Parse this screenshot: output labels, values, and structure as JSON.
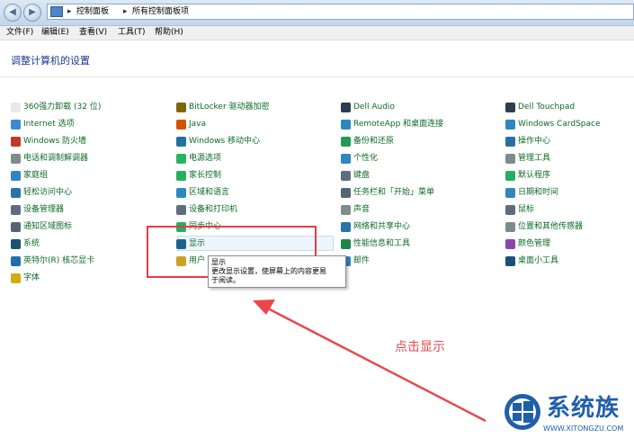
{
  "breadcrumb": [
    "控制面板",
    "所有控制面板项"
  ],
  "menu": [
    "文件(F)",
    "编辑(E)",
    "查看(V)",
    "工具(T)",
    "帮助(H)"
  ],
  "page_title": "调整计算机的设置",
  "columns": [
    [
      {
        "label": "360强力卸载 (32 位)",
        "icon_color": "#e9e9e9"
      },
      {
        "label": "Internet 选项",
        "icon_color": "#3b8ad9"
      },
      {
        "label": "Windows 防火墙",
        "icon_color": "#c0392b"
      },
      {
        "label": "电话和调制解调器",
        "icon_color": "#7f8c8d"
      },
      {
        "label": "家庭组",
        "icon_color": "#2e86c1"
      },
      {
        "label": "轻松访问中心",
        "icon_color": "#2874a6"
      },
      {
        "label": "设备管理器",
        "icon_color": "#5d6d7e"
      },
      {
        "label": "通知区域图标",
        "icon_color": "#566573"
      },
      {
        "label": "系统",
        "icon_color": "#1a5276"
      },
      {
        "label": "英特尔(R) 核芯显卡",
        "icon_color": "#1f6fb2"
      },
      {
        "label": "字体",
        "icon_color": "#d4ac0d"
      }
    ],
    [
      {
        "label": "BitLocker 驱动器加密",
        "icon_color": "#7d6608"
      },
      {
        "label": "Java",
        "icon_color": "#d35400"
      },
      {
        "label": "Windows 移动中心",
        "icon_color": "#2471a3"
      },
      {
        "label": "电源选项",
        "icon_color": "#28b463"
      },
      {
        "label": "家长控制",
        "icon_color": "#27ae60"
      },
      {
        "label": "区域和语言",
        "icon_color": "#2e86c1"
      },
      {
        "label": "设备和打印机",
        "icon_color": "#5d6d7e"
      },
      {
        "label": "同步中心",
        "icon_color": "#27ae60"
      },
      {
        "label": "显示",
        "icon_color": "#1f618d"
      },
      {
        "label": "用户",
        "icon_color": "#c9a227"
      }
    ],
    [
      {
        "label": "Dell Audio",
        "icon_color": "#2c3e50"
      },
      {
        "label": "RemoteApp 和桌面连接",
        "icon_color": "#2e86c1"
      },
      {
        "label": "备份和还原",
        "icon_color": "#229954"
      },
      {
        "label": "个性化",
        "icon_color": "#2e86c1"
      },
      {
        "label": "键盘",
        "icon_color": "#5d6d7e"
      },
      {
        "label": "任务栏和「开始」菜单",
        "icon_color": "#566573"
      },
      {
        "label": "声音",
        "icon_color": "#7f8c8d"
      },
      {
        "label": "网络和共享中心",
        "icon_color": "#2874a6"
      },
      {
        "label": "性能信息和工具",
        "icon_color": "#1e8449"
      },
      {
        "label": "邮件",
        "icon_color": "#2e86c1"
      }
    ],
    [
      {
        "label": "Dell Touchpad",
        "icon_color": "#2c3e50"
      },
      {
        "label": "Windows CardSpace",
        "icon_color": "#2e86c1"
      },
      {
        "label": "操作中心",
        "icon_color": "#2471a3"
      },
      {
        "label": "管理工具",
        "icon_color": "#7f8c8d"
      },
      {
        "label": "默认程序",
        "icon_color": "#27ae60"
      },
      {
        "label": "日期和时间",
        "icon_color": "#2e86c1"
      },
      {
        "label": "鼠标",
        "icon_color": "#5d6d7e"
      },
      {
        "label": "位置和其他传感器",
        "icon_color": "#7d8b8c"
      },
      {
        "label": "颜色管理",
        "icon_color": "#8e44ad"
      },
      {
        "label": "桌面小工具",
        "icon_color": "#1a5276"
      }
    ]
  ],
  "tooltip": {
    "title": "显示",
    "lines": [
      "更改显示设置，使屏幕上的内容更易",
      "于阅读。"
    ]
  },
  "annotation": "点击显示",
  "watermark": {
    "text": "系统族",
    "url": "WWW.XITONGZU.COM"
  },
  "colors": {
    "link": "#0b6a28",
    "heading": "#1e3a8a",
    "annotation": "#e8484c",
    "highlight": "#ea3a44"
  }
}
